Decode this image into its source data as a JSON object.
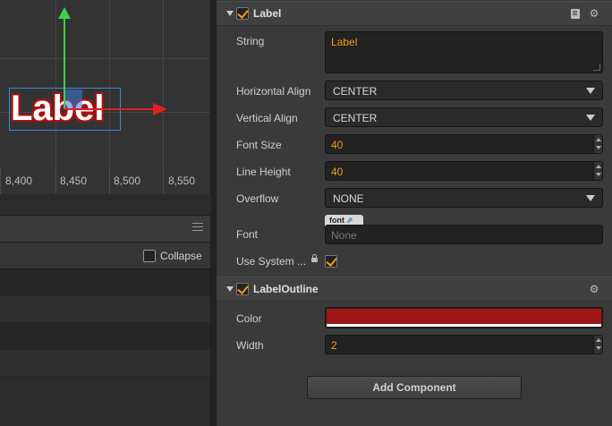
{
  "scene": {
    "label_preview": "Label",
    "ruler": [
      "8,400",
      "8,450",
      "8,500",
      "8,550"
    ]
  },
  "lower_panel": {
    "collapse_label": "Collapse"
  },
  "label_component": {
    "title": "Label",
    "enabled": true,
    "string_label": "String",
    "string_value": "Label",
    "h_align_label": "Horizontal Align",
    "h_align_value": "CENTER",
    "v_align_label": "Vertical Align",
    "v_align_value": "CENTER",
    "font_size_label": "Font Size",
    "font_size_value": "40",
    "line_height_label": "Line Height",
    "line_height_value": "40",
    "overflow_label": "Overflow",
    "overflow_value": "NONE",
    "font_label": "Font",
    "font_tag": "font",
    "font_value": "None",
    "use_system_label": "Use System ...",
    "use_system_checked": true
  },
  "outline_component": {
    "title": "LabelOutline",
    "enabled": true,
    "color_label": "Color",
    "color_value": "#9e1616",
    "width_label": "Width",
    "width_value": "2"
  },
  "add_component_label": "Add Component",
  "colors": {
    "accent": "#f39c12",
    "selection": "#3b88d6",
    "axis_x": "#e02020",
    "axis_y": "#3fcf4a"
  }
}
